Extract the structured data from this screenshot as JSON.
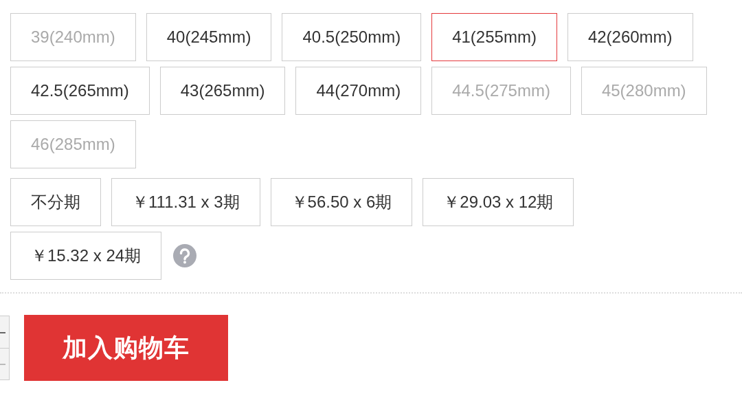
{
  "sizes": [
    {
      "label": "39(240mm)",
      "selected": false,
      "disabled": true
    },
    {
      "label": "40(245mm)",
      "selected": false,
      "disabled": false
    },
    {
      "label": "40.5(250mm)",
      "selected": false,
      "disabled": false
    },
    {
      "label": "41(255mm)",
      "selected": true,
      "disabled": false
    },
    {
      "label": "42(260mm)",
      "selected": false,
      "disabled": false
    },
    {
      "label": "42.5(265mm)",
      "selected": false,
      "disabled": false
    },
    {
      "label": "43(265mm)",
      "selected": false,
      "disabled": false
    },
    {
      "label": "44(270mm)",
      "selected": false,
      "disabled": false
    },
    {
      "label": "44.5(275mm)",
      "selected": false,
      "disabled": true
    },
    {
      "label": "45(280mm)",
      "selected": false,
      "disabled": true
    },
    {
      "label": "46(285mm)",
      "selected": false,
      "disabled": true
    }
  ],
  "installments": [
    {
      "label": "不分期",
      "selected": false
    },
    {
      "label": "￥111.31 x 3期",
      "selected": false
    },
    {
      "label": "￥56.50 x 6期",
      "selected": false
    },
    {
      "label": "￥29.03 x 12期",
      "selected": false
    },
    {
      "label": "￥15.32 x 24期",
      "selected": false
    }
  ],
  "add_to_cart": "加入购物车"
}
